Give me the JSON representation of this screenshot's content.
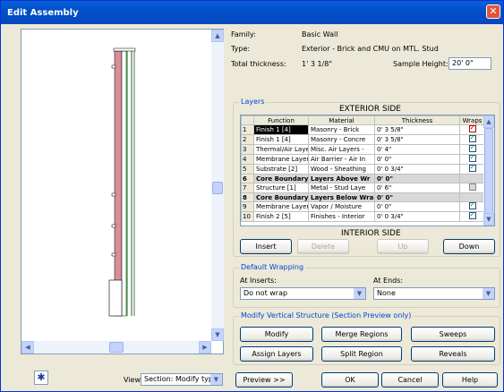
{
  "window": {
    "title": "Edit Assembly",
    "close_label": "✕"
  },
  "info": {
    "family_label": "Family:",
    "family_value": "Basic Wall",
    "type_label": "Type:",
    "type_value": "Exterior - Brick and CMU on MTL. Stud",
    "thickness_label": "Total thickness:",
    "thickness_value": "1' 3 1/8\"",
    "sample_height_label": "Sample Height:",
    "sample_height_value": "20' 0\""
  },
  "layers": {
    "group_label": "Layers",
    "exterior_side": "EXTERIOR SIDE",
    "interior_side": "INTERIOR SIDE",
    "columns": [
      "",
      "Function",
      "Material",
      "Thickness",
      "Wraps"
    ],
    "rows": [
      {
        "num": "1",
        "function": "Finish 1 [4]",
        "material": "Masonry - Brick",
        "thickness": "0' 3 5/8\"",
        "wraps": "red",
        "bold": false,
        "selected": true
      },
      {
        "num": "2",
        "function": "Finish 1 [4]",
        "material": "Masonry - Concre",
        "thickness": "0' 3 5/8\"",
        "wraps": "on",
        "bold": false,
        "selected": false
      },
      {
        "num": "3",
        "function": "Thermal/Air Laye",
        "material": "Misc. Air Layers -",
        "thickness": "0' 4\"",
        "wraps": "on",
        "bold": false,
        "selected": false
      },
      {
        "num": "4",
        "function": "Membrane Layer",
        "material": "Air Barrier - Air In",
        "thickness": "0' 0\"",
        "wraps": "on",
        "bold": false,
        "selected": false
      },
      {
        "num": "5",
        "function": "Substrate [2]",
        "material": "Wood - Sheathing",
        "thickness": "0' 0 3/4\"",
        "wraps": "on",
        "bold": false,
        "selected": false
      },
      {
        "num": "6",
        "function": "Core Boundary",
        "material": "Layers Above Wr",
        "thickness": "0' 0\"",
        "wraps": "",
        "bold": true,
        "selected": false
      },
      {
        "num": "7",
        "function": "Structure [1]",
        "material": "Metal - Stud Laye",
        "thickness": "0' 6\"",
        "wraps": "gray",
        "bold": false,
        "selected": false
      },
      {
        "num": "8",
        "function": "Core Boundary",
        "material": "Layers Below Wra",
        "thickness": "0' 0\"",
        "wraps": "",
        "bold": true,
        "selected": false
      },
      {
        "num": "9",
        "function": "Membrane Layer",
        "material": "Vapor / Moisture",
        "thickness": "0' 0\"",
        "wraps": "on",
        "bold": false,
        "selected": false
      },
      {
        "num": "10",
        "function": "Finish 2 [5]",
        "material": "Finishes - Interior",
        "thickness": "0' 0 3/4\"",
        "wraps": "on",
        "bold": false,
        "selected": false
      }
    ],
    "buttons": {
      "insert": "Insert",
      "delete": "Delete",
      "up": "Up",
      "down": "Down"
    }
  },
  "default_wrapping": {
    "group_label": "Default Wrapping",
    "at_inserts_label": "At Inserts:",
    "at_inserts_value": "Do not wrap",
    "at_ends_label": "At Ends:",
    "at_ends_value": "None"
  },
  "modify_vertical": {
    "group_label": "Modify Vertical Structure (Section Preview only)",
    "buttons": {
      "modify": "Modify",
      "merge": "Merge Regions",
      "sweeps": "Sweeps",
      "assign": "Assign Layers",
      "split": "Split Region",
      "reveals": "Reveals"
    }
  },
  "bottom": {
    "view_label": "View:",
    "view_value": "Section: Modify type",
    "preview": "Preview >>",
    "ok": "OK",
    "cancel": "Cancel",
    "help": "Help"
  },
  "colors": {
    "title_bar": "#0a5fd8",
    "wall_brick": "#d98f9a",
    "wall_stud": "#2f8f2f",
    "group_label": "#0046d5"
  }
}
